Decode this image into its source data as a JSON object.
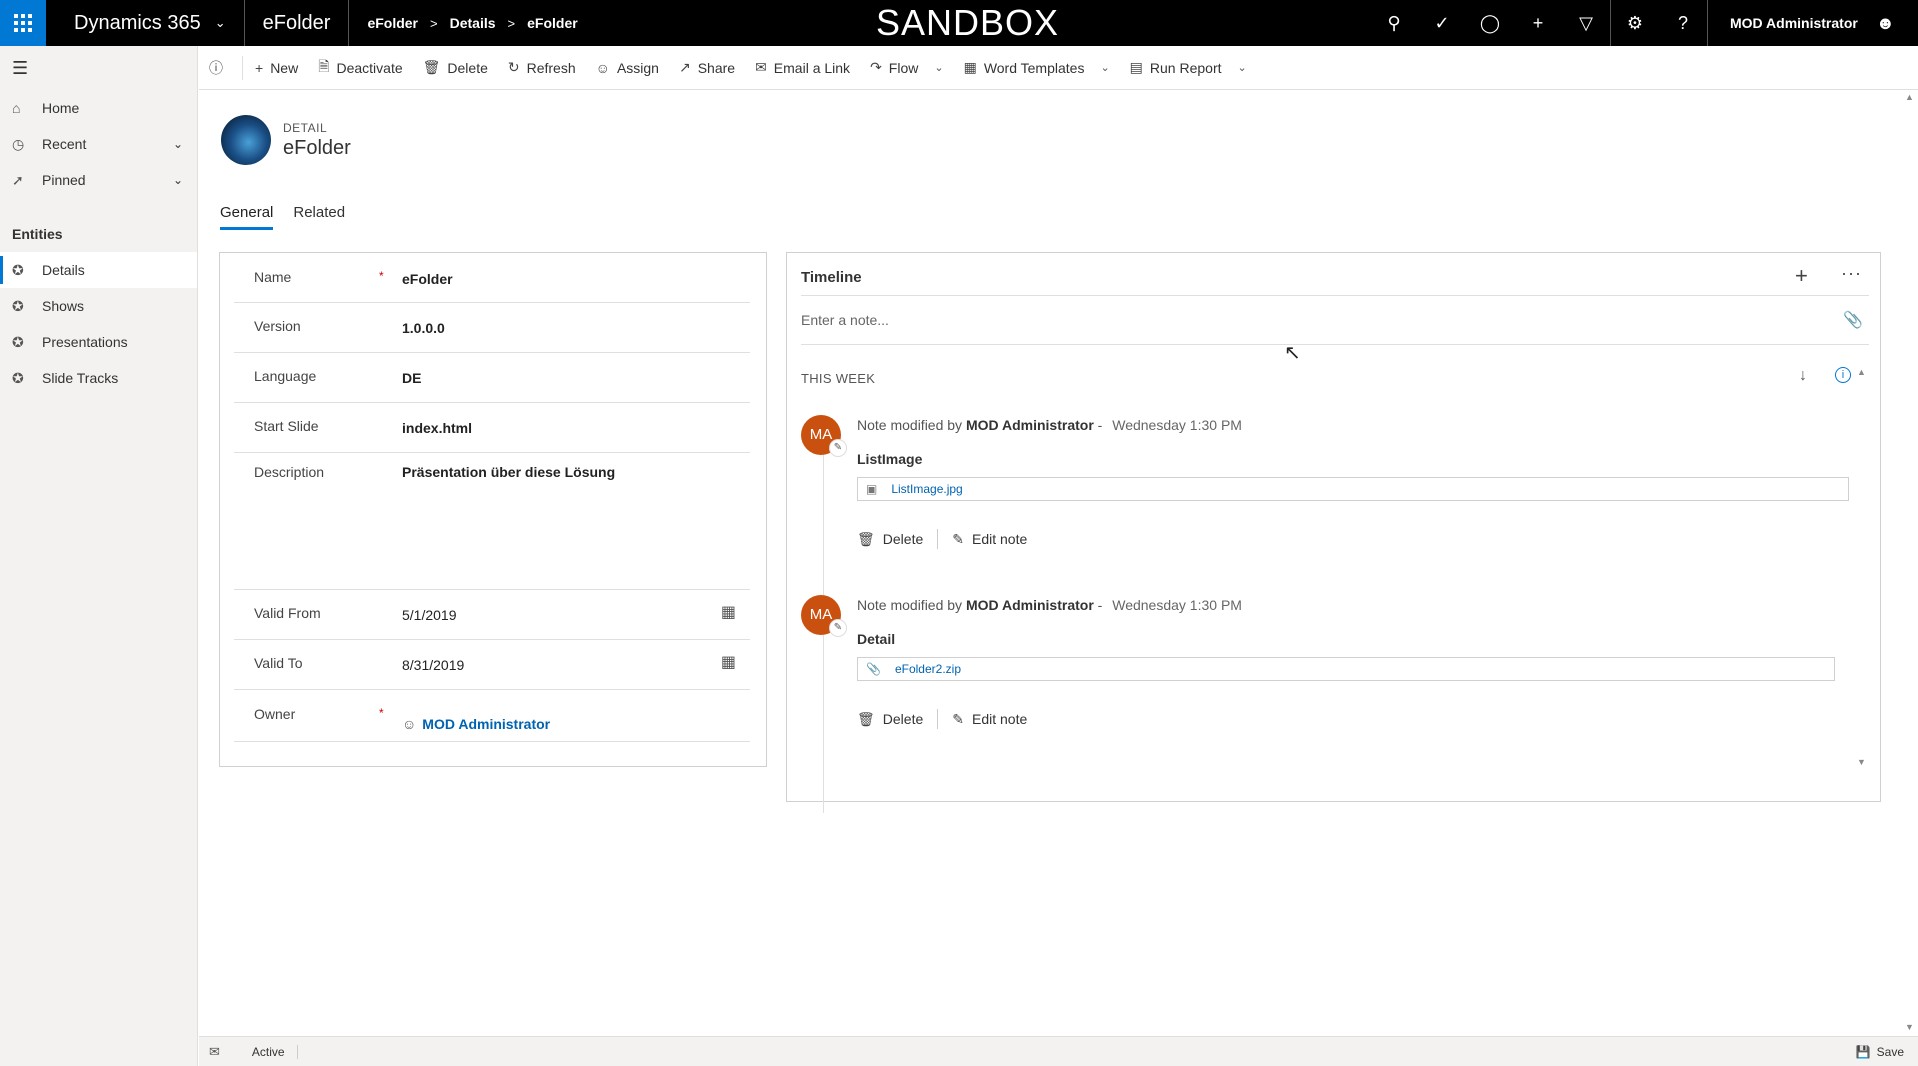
{
  "topbar": {
    "brand": "Dynamics 365",
    "app": "eFolder",
    "breadcrumbs": [
      "eFolder",
      "Details",
      "eFolder"
    ],
    "banner": "SANDBOX",
    "user": "MOD Administrator"
  },
  "leftnav": {
    "items": [
      {
        "label": "Home"
      },
      {
        "label": "Recent"
      },
      {
        "label": "Pinned"
      }
    ],
    "group": "Entities",
    "entities": [
      {
        "label": "Details",
        "active": true
      },
      {
        "label": "Shows"
      },
      {
        "label": "Presentations"
      },
      {
        "label": "Slide Tracks"
      }
    ]
  },
  "commands": {
    "new": "New",
    "deactivate": "Deactivate",
    "delete": "Delete",
    "refresh": "Refresh",
    "assign": "Assign",
    "share": "Share",
    "email_link": "Email a Link",
    "flow": "Flow",
    "word_templates": "Word Templates",
    "run_report": "Run Report"
  },
  "record": {
    "type": "DETAIL",
    "title": "eFolder"
  },
  "tabs": [
    "General",
    "Related"
  ],
  "form": {
    "name_label": "Name",
    "name_value": "eFolder",
    "version_label": "Version",
    "version_value": "1.0.0.0",
    "language_label": "Language",
    "language_value": "DE",
    "start_label": "Start Slide",
    "start_value": "index.html",
    "desc_label": "Description",
    "desc_value": "Präsentation über diese Lösung",
    "from_label": "Valid From",
    "from_value": "5/1/2019",
    "to_label": "Valid To",
    "to_value": "8/31/2019",
    "owner_label": "Owner",
    "owner_value": "MOD Administrator",
    "required_mark": "*"
  },
  "timeline": {
    "title": "Timeline",
    "note_placeholder": "Enter a note...",
    "period": "THIS WEEK",
    "entries": [
      {
        "initials": "MA",
        "prefix": "Note modified by",
        "author": "MOD Administrator",
        "dash": "-",
        "time": "Wednesday 1:30 PM",
        "subject": "ListImage",
        "attachment": "ListImage.jpg",
        "delete": "Delete",
        "edit": "Edit note"
      },
      {
        "initials": "MA",
        "prefix": "Note modified by",
        "author": "MOD Administrator",
        "dash": "-",
        "time": "Wednesday 1:30 PM",
        "subject": "Detail",
        "attachment": "eFolder2.zip",
        "delete": "Delete",
        "edit": "Edit note"
      }
    ]
  },
  "statusbar": {
    "status": "Active",
    "save": "Save"
  },
  "colors": {
    "accent": "#0078d4",
    "avatar": "#ca5010",
    "topbar": "#000000"
  }
}
